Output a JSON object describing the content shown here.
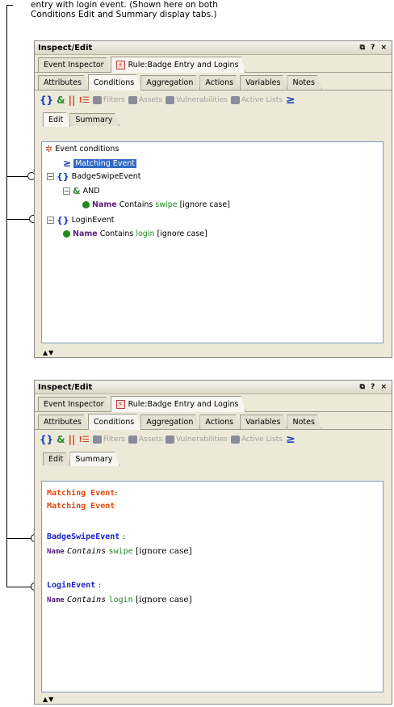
{
  "caption": {
    "line1": "entry with login event. (Shown here on both",
    "line2": "Conditions Edit and Summary display tabs.)"
  },
  "panel": {
    "title": "Inspect/Edit",
    "window_controls": "⧉ ? ×",
    "tabs": [
      "Event Inspector",
      "Rule:Badge Entry and Logins"
    ],
    "section_tabs": [
      "Attributes",
      "Conditions",
      "Aggregation",
      "Actions",
      "Variables",
      "Notes"
    ],
    "toolbar": {
      "filters": "Filters",
      "assets": "Assets",
      "vulnerabilities": "Vulnerabilities",
      "active_lists": "Active Lists"
    },
    "view_tabs": [
      "Edit",
      "Summary"
    ],
    "scroll_arrows": "▲▼"
  },
  "tree": {
    "root": "Event conditions",
    "matching": "Matching Event",
    "badge": "BadgeSwipeEvent",
    "and": "AND",
    "badge_cond": {
      "field": "Name",
      "op": "Contains",
      "value": "swipe",
      "suffix": "[ignore case]"
    },
    "login": "LoginEvent",
    "login_cond": {
      "field": "Name",
      "op": "Contains",
      "value": "login",
      "suffix": "[ignore case]"
    }
  },
  "summary": {
    "matching1": "Matching Event",
    "matching1_colon": ":",
    "matching2": "Matching Event",
    "badge": "BadgeSwipeEvent",
    "badge_colon": ":",
    "badge_field": "Name",
    "badge_op": "Contains",
    "badge_value": "swipe",
    "badge_suffix": "[ignore case]",
    "login": "LoginEvent",
    "login_colon": ":",
    "login_field": "Name",
    "login_op": "Contains",
    "login_value": "login",
    "login_suffix": "[ignore case]"
  },
  "colors": {
    "panel_bg": "#ece9d8",
    "selection": "#316ac5",
    "summary_orange": "#e04a10",
    "summary_blue": "#1a24c8",
    "value_green": "#1f8a1f",
    "field_purple": "#5a1f7a"
  }
}
